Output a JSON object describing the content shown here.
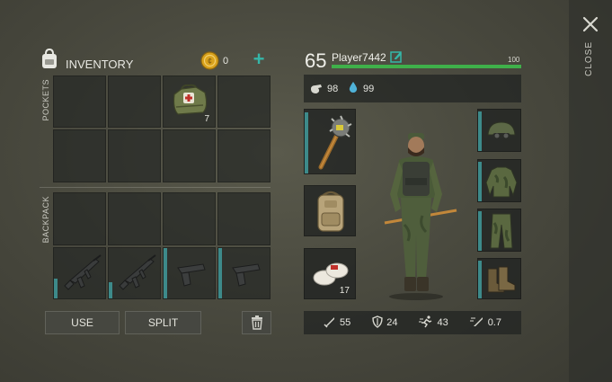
{
  "inventory": {
    "title": "INVENTORY",
    "coins": "0",
    "add_symbol": "+",
    "pockets_label": "POCKETS",
    "backpack_label": "BACKPACK",
    "pocket_items": [
      {
        "slot": 2,
        "name": "medkit-bag-icon",
        "qty": "7"
      }
    ],
    "backpack_items": [
      {
        "slot": 4,
        "name": "assault-rifle-icon"
      },
      {
        "slot": 5,
        "name": "assault-rifle-icon"
      },
      {
        "slot": 6,
        "name": "pistol-icon"
      },
      {
        "slot": 7,
        "name": "pistol-icon"
      }
    ],
    "use_label": "USE",
    "split_label": "SPLIT"
  },
  "player": {
    "level": "65",
    "name": "Player7442",
    "hp_value": "100",
    "hp_fraction": 1.0,
    "hunger": "98",
    "thirst": "99"
  },
  "equipment": {
    "weapon": "spiked-hammer-icon",
    "backpack": "backpack-icon",
    "consumable": "bandage-icon",
    "consumable_qty": "17",
    "head": "helmet-icon",
    "body": "camo-jacket-icon",
    "legs": "camo-pants-icon",
    "feet": "boots-icon"
  },
  "stats": {
    "attack": "55",
    "defense": "24",
    "speed": "43",
    "attack_speed": "0.7"
  },
  "close_label": "CLOSE",
  "colors": {
    "hp_bar": "#3fb04a",
    "accent_teal": "#3d8a8a",
    "coin": "#d9a21c",
    "plus": "#35b6a8"
  }
}
